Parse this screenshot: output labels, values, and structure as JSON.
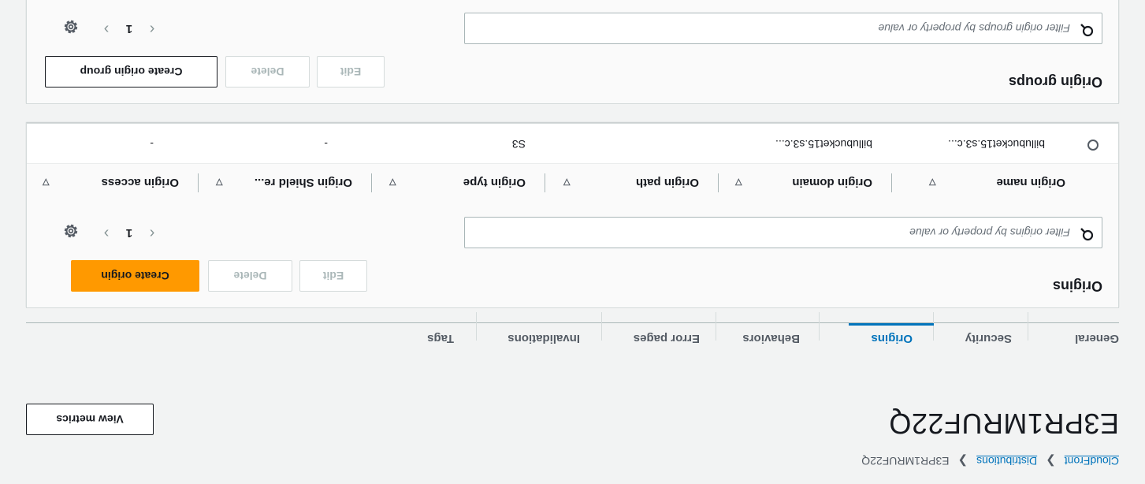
{
  "breadcrumb": {
    "service": "CloudFront",
    "section": "Distributions",
    "current": "E3PR1MRUF22Q"
  },
  "page": {
    "title": "E3PR1MRUF22Q",
    "view_metrics_label": "View metrics"
  },
  "tabs": [
    {
      "label": "General"
    },
    {
      "label": "Security"
    },
    {
      "label": "Origins"
    },
    {
      "label": "Behaviors"
    },
    {
      "label": "Error pages"
    },
    {
      "label": "Invalidations"
    },
    {
      "label": "Tags"
    }
  ],
  "active_tab": "Origins",
  "origins": {
    "title": "Origins",
    "edit_label": "Edit",
    "delete_label": "Delete",
    "create_label": "Create origin",
    "search_placeholder": "Filter origins by property or value",
    "page_number": "1",
    "columns": [
      "Origin name",
      "Origin domain",
      "Origin path",
      "Origin type",
      "Origin Shield re...",
      "Origin access"
    ],
    "rows": [
      {
        "name": "billubucket15.s3.c...",
        "domain": "billubucket15.s3.c...",
        "path": "",
        "type": "S3",
        "shield": "-",
        "access": "-"
      }
    ]
  },
  "origin_groups": {
    "title": "Origin groups",
    "edit_label": "Edit",
    "delete_label": "Delete",
    "create_label": "Create origin group",
    "search_placeholder": "Filter origin groups by property or value",
    "page_number": "1"
  },
  "colors": {
    "accent": "#0073bb",
    "primary_button": "#ff9900",
    "background": "#f2f3f3"
  }
}
